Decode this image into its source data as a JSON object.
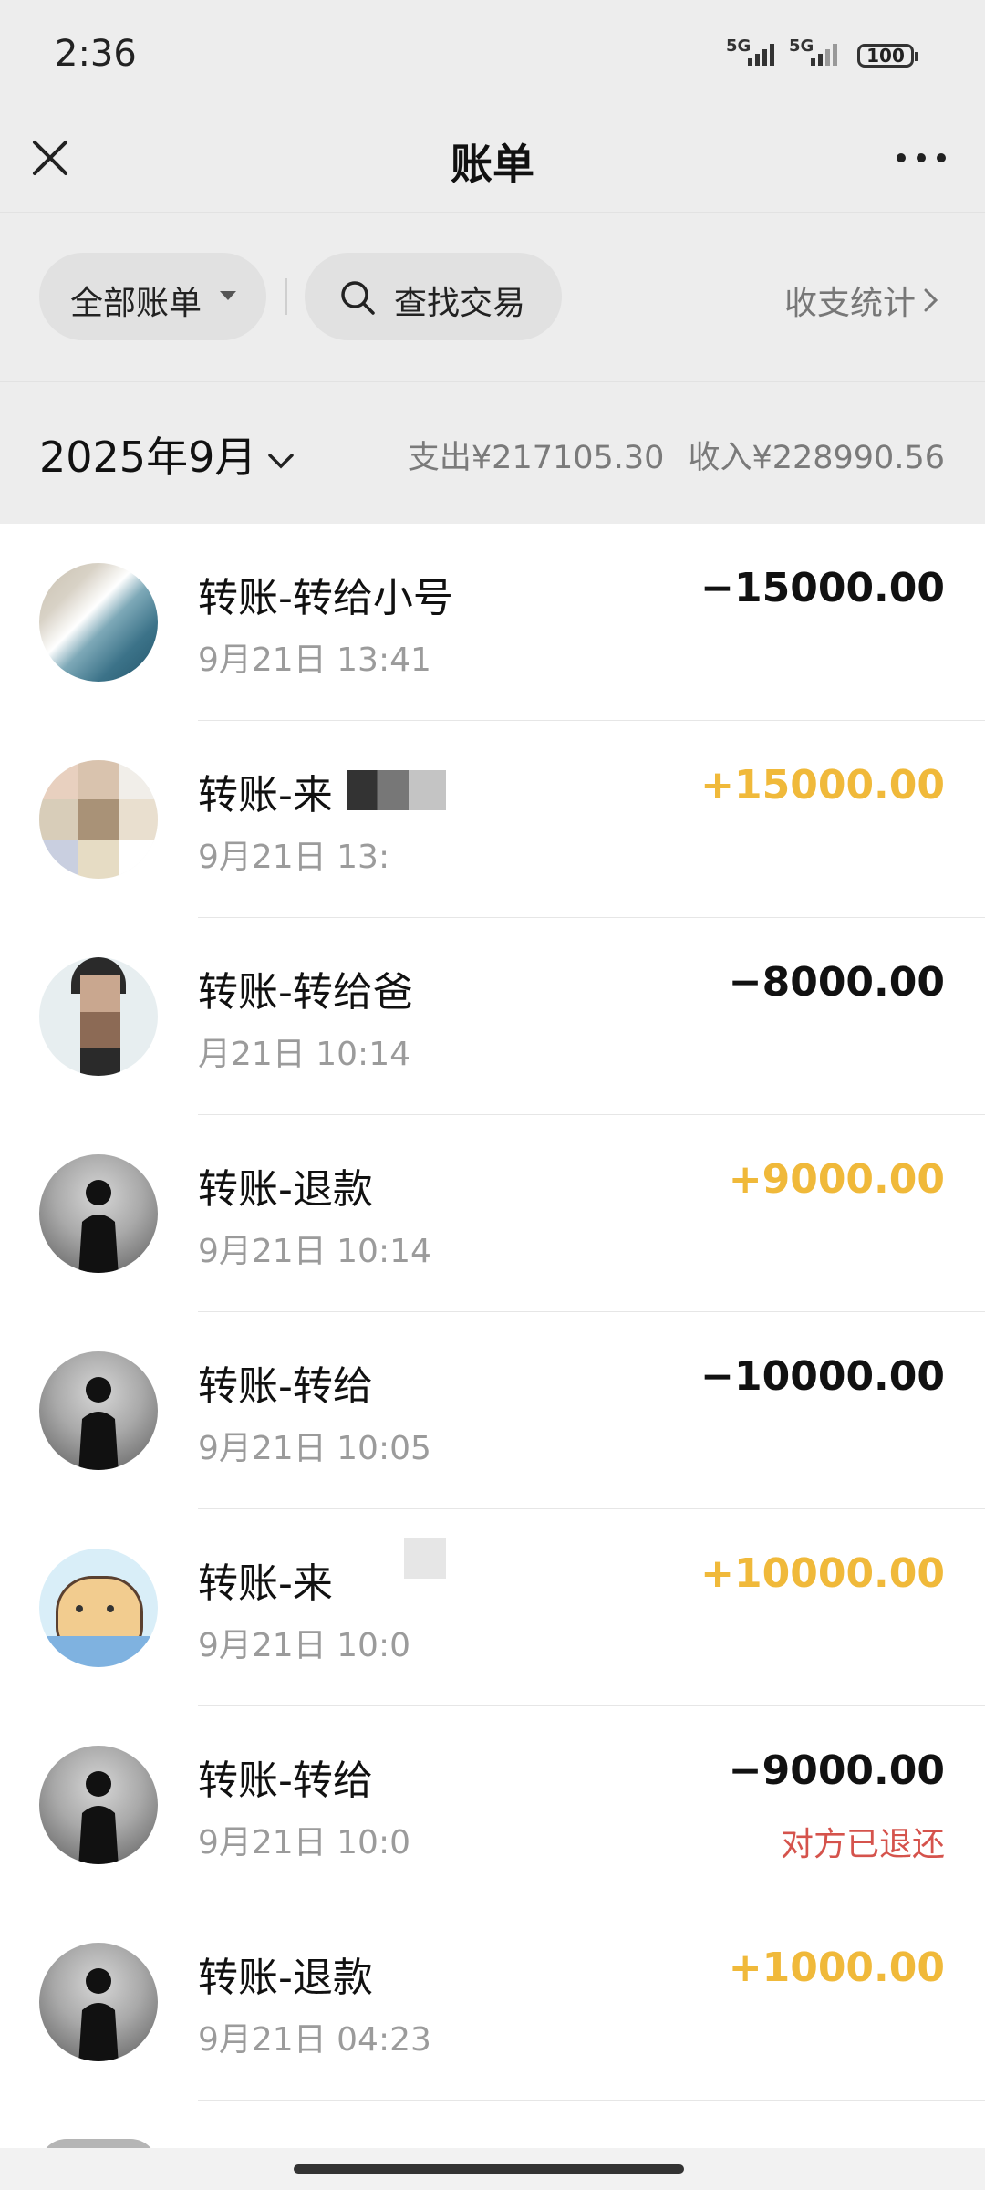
{
  "status_bar": {
    "time": "2:36",
    "signal1_label": "5G",
    "signal2_label": "5G",
    "battery": "100"
  },
  "header": {
    "title": "账单",
    "close_icon": "close-icon",
    "more_icon": "more-icon"
  },
  "filters": {
    "all_bills_label": "全部账单",
    "search_label": "查找交易",
    "stats_label": "收支统计"
  },
  "month_bar": {
    "month": "2025年9月",
    "expense": "支出¥217105.30",
    "income": "收入¥228990.56"
  },
  "transactions": [
    {
      "title": "转账-转给小号",
      "time": "9月21日 13:41",
      "amount": "−15000.00",
      "direction": "out",
      "avatar": "sea-photo",
      "note": ""
    },
    {
      "title": "转账-来",
      "time": "9月21日 13:",
      "amount": "+15000.00",
      "direction": "in",
      "avatar": "pixelated",
      "note": ""
    },
    {
      "title": "转账-转给爸",
      "time": "月21日 10:14",
      "amount": "−8000.00",
      "direction": "out",
      "avatar": "face-blurred",
      "note": ""
    },
    {
      "title": "转账-退款",
      "time": "9月21日 10:14",
      "amount": "+9000.00",
      "direction": "in",
      "avatar": "silhouette",
      "note": ""
    },
    {
      "title": "转账-转给",
      "time": "9月21日 10:05",
      "amount": "−10000.00",
      "direction": "out",
      "avatar": "silhouette",
      "note": ""
    },
    {
      "title": "转账-来",
      "time": "9月21日 10:0",
      "amount": "+10000.00",
      "direction": "in",
      "avatar": "cartoon-cat",
      "note": ""
    },
    {
      "title": "转账-转给",
      "time": "9月21日 10:0",
      "amount": "−9000.00",
      "direction": "out",
      "avatar": "silhouette",
      "note": "对方已退还"
    },
    {
      "title": "转账-退款",
      "time": "9月21日 04:23",
      "amount": "+1000.00",
      "direction": "in",
      "avatar": "silhouette",
      "note": ""
    }
  ],
  "colors": {
    "income": "#f0b93a",
    "expense": "#111111",
    "refund_note": "#d5534c",
    "page_bg": "#ededed"
  }
}
